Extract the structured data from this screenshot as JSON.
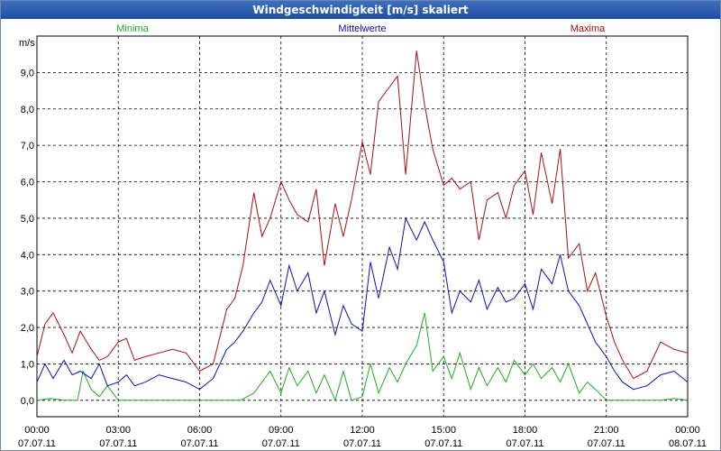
{
  "window": {
    "title": "Windgeschwindigkeit [m/s] skaliert"
  },
  "colors": {
    "minima": "#22aa22",
    "mittel": "#1010b0",
    "maxima": "#aa1010",
    "grid": "#000000"
  },
  "chart_data": {
    "type": "line",
    "title": "Windgeschwindigkeit [m/s] skaliert",
    "ylabel": "m/s",
    "ylim": [
      -0.45,
      10.0
    ],
    "xlim_hours": [
      0,
      24
    ],
    "grid": true,
    "y_ticks": [
      "0,0",
      "1,0",
      "2,0",
      "3,0",
      "4,0",
      "5,0",
      "6,0",
      "7,0",
      "8,0",
      "9,0"
    ],
    "x_ticks": [
      {
        "time": "00:00",
        "date": "07.07.11"
      },
      {
        "time": "03:00",
        "date": "07.07.11"
      },
      {
        "time": "06:00",
        "date": "07.07.11"
      },
      {
        "time": "09:00",
        "date": "07.07.11"
      },
      {
        "time": "12:00",
        "date": "07.07.11"
      },
      {
        "time": "15:00",
        "date": "07.07.11"
      },
      {
        "time": "18:00",
        "date": "07.07.11"
      },
      {
        "time": "21:00",
        "date": "07.07.11"
      },
      {
        "time": "00:00",
        "date": "08.07.11"
      }
    ],
    "series": [
      {
        "name": "Minima",
        "color": "#22aa22",
        "x": [
          0,
          0.5,
          1,
          1.5,
          1.7,
          2,
          2.3,
          2.6,
          3,
          3.5,
          4,
          5,
          6,
          6.5,
          7,
          7.5,
          8,
          8.3,
          8.6,
          9,
          9.3,
          9.6,
          10,
          10.3,
          10.6,
          11,
          11.3,
          11.6,
          12,
          12.3,
          12.6,
          13,
          13.3,
          13.6,
          14,
          14.3,
          14.6,
          15,
          15.3,
          15.6,
          16,
          16.3,
          16.6,
          17,
          17.3,
          17.6,
          18,
          18.3,
          18.6,
          19,
          19.3,
          19.6,
          20,
          20.3,
          20.6,
          21,
          21.5,
          22,
          22.5,
          23,
          23.5,
          24
        ],
        "y": [
          0,
          0.05,
          0,
          0,
          0.8,
          0.3,
          0.1,
          0.4,
          0,
          0,
          0,
          0,
          0,
          0,
          0,
          0,
          0.2,
          0.5,
          0.8,
          0.2,
          0.9,
          0.4,
          0.8,
          0.2,
          0.7,
          0,
          0.8,
          0,
          0.1,
          1.0,
          0.2,
          0.9,
          0.5,
          1.0,
          1.5,
          2.4,
          0.8,
          1.2,
          0.6,
          1.3,
          0.3,
          0.9,
          0.4,
          0.9,
          0.5,
          1.1,
          0.7,
          1.0,
          0.6,
          0.9,
          0.5,
          1.0,
          0.2,
          0.5,
          0.3,
          0,
          0,
          0,
          0,
          0,
          0.05,
          0
        ]
      },
      {
        "name": "Mittelwerte",
        "color": "#1010b0",
        "x": [
          0,
          0.3,
          0.6,
          1,
          1.3,
          1.6,
          2,
          2.3,
          2.6,
          3,
          3.3,
          3.6,
          4,
          4.5,
          5,
          5.5,
          6,
          6.5,
          7,
          7.3,
          7.6,
          8,
          8.3,
          8.6,
          9,
          9.3,
          9.6,
          10,
          10.3,
          10.6,
          11,
          11.3,
          11.6,
          12,
          12.3,
          12.6,
          13,
          13.3,
          13.6,
          14,
          14.3,
          14.6,
          15,
          15.3,
          15.6,
          16,
          16.3,
          16.6,
          17,
          17.3,
          17.6,
          18,
          18.3,
          18.6,
          19,
          19.3,
          19.6,
          20,
          20.3,
          20.6,
          21,
          21.3,
          21.6,
          22,
          22.5,
          23,
          23.5,
          24
        ],
        "y": [
          0.5,
          1.0,
          0.6,
          1.1,
          0.7,
          0.8,
          0.6,
          1.0,
          0.4,
          0.5,
          0.7,
          0.4,
          0.5,
          0.7,
          0.6,
          0.5,
          0.3,
          0.6,
          1.4,
          1.6,
          1.9,
          2.4,
          2.7,
          3.3,
          2.6,
          3.7,
          3.0,
          3.5,
          2.4,
          3.0,
          1.8,
          2.6,
          2.1,
          1.9,
          3.8,
          2.8,
          4.2,
          3.6,
          5.0,
          4.4,
          4.9,
          4.4,
          3.8,
          2.4,
          3.0,
          2.7,
          3.3,
          2.5,
          3.1,
          2.7,
          2.8,
          3.2,
          2.5,
          3.6,
          3.2,
          4.0,
          3.0,
          2.6,
          2.1,
          1.6,
          1.2,
          0.8,
          0.5,
          0.3,
          0.4,
          0.7,
          0.8,
          0.5
        ]
      },
      {
        "name": "Maxima",
        "color": "#aa1010",
        "x": [
          0,
          0.3,
          0.6,
          1,
          1.3,
          1.6,
          2,
          2.3,
          2.6,
          3,
          3.3,
          3.6,
          4,
          4.5,
          5,
          5.5,
          6,
          6.5,
          7,
          7.3,
          7.6,
          8,
          8.3,
          8.6,
          9,
          9.3,
          9.6,
          10,
          10.3,
          10.6,
          11,
          11.3,
          11.6,
          12,
          12.3,
          12.6,
          13,
          13.3,
          13.6,
          14,
          14.3,
          14.6,
          15,
          15.3,
          15.6,
          16,
          16.3,
          16.6,
          17,
          17.3,
          17.6,
          18,
          18.3,
          18.6,
          19,
          19.3,
          19.6,
          20,
          20.3,
          20.6,
          21,
          21.3,
          21.6,
          22,
          22.5,
          23,
          23.5,
          24
        ],
        "y": [
          1.2,
          2.1,
          2.4,
          1.8,
          1.3,
          1.9,
          1.4,
          1.1,
          1.2,
          1.6,
          1.7,
          1.1,
          1.2,
          1.3,
          1.4,
          1.3,
          0.8,
          1.0,
          2.5,
          2.8,
          3.7,
          5.7,
          4.5,
          5.0,
          6.0,
          5.5,
          5.1,
          4.9,
          5.8,
          3.7,
          5.4,
          4.5,
          5.5,
          7.1,
          6.2,
          8.2,
          8.6,
          8.9,
          6.2,
          9.6,
          8.1,
          6.9,
          5.9,
          6.1,
          5.8,
          6.0,
          4.4,
          5.5,
          5.7,
          5.0,
          5.9,
          6.3,
          5.1,
          6.8,
          5.4,
          6.9,
          3.9,
          4.3,
          3.0,
          3.5,
          2.3,
          1.6,
          1.1,
          0.6,
          0.8,
          1.6,
          1.4,
          1.3
        ]
      }
    ]
  }
}
